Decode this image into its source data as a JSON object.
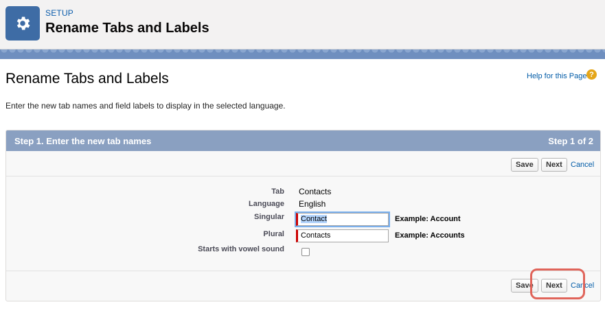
{
  "header": {
    "eyebrow": "SETUP",
    "title": "Rename Tabs and Labels",
    "icon": "gear-icon"
  },
  "page": {
    "title": "Rename Tabs and Labels",
    "help_link": "Help for this Page",
    "help_icon": "?",
    "intro": "Enter the new tab names and field labels to display in the selected language."
  },
  "panel": {
    "step_title": "Step 1. Enter the new tab names",
    "step_count": "Step 1 of 2",
    "buttons": {
      "save": "Save",
      "next": "Next",
      "cancel": "Cancel"
    }
  },
  "form": {
    "tab_label": "Tab",
    "tab_value": "Contacts",
    "language_label": "Language",
    "language_value": "English",
    "singular_label": "Singular",
    "singular_value": "Contact",
    "singular_example": "Example: Account",
    "plural_label": "Plural",
    "plural_value": "Contacts",
    "plural_example": "Example: Accounts",
    "vowel_label": "Starts with vowel sound",
    "vowel_checked": false
  },
  "colors": {
    "accent": "#3e6ca5",
    "panel_header": "#8aa0c1",
    "link": "#015ba7",
    "required": "#cc0000",
    "annotation": "#e0645a"
  }
}
